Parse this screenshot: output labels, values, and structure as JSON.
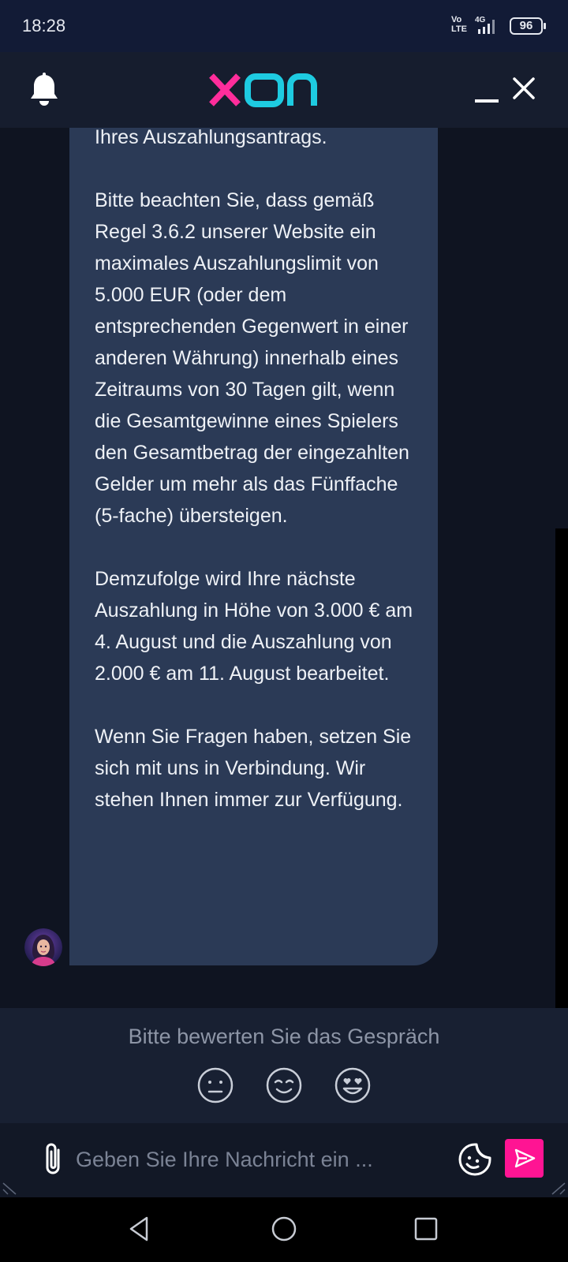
{
  "status_bar": {
    "time": "18:28",
    "network_line1": "Vo",
    "network_line2": "LTE",
    "network_type": "4G",
    "battery": "96"
  },
  "header": {
    "logo_text": "xon",
    "icons": [
      "bell-icon",
      "minimize-icon",
      "close-icon"
    ],
    "logo_colors": {
      "x": "#ff2d9b",
      "on": "#1ecbe1"
    }
  },
  "chat": {
    "message": {
      "paragraphs": [
        "Ihres Auszahlungsantrags.",
        "Bitte beachten Sie, dass gemäß Regel 3.6.2 unserer Website ein maximales Auszahlungslimit von 5.000 EUR (oder dem entsprechenden Gegenwert in einer anderen Währung) innerhalb eines Zeitraums von 30 Tagen gilt, wenn die Gesamtgewinne eines Spielers den Gesamtbetrag der eingezahlten Gelder um mehr als das Fünffache (5-fache) übersteigen.",
        "Demzufolge wird Ihre nächste Auszahlung in Höhe von 3.000 € am 4. August und die Auszahlung von 2.000 € am 11. August bearbeitet.",
        "Wenn Sie Fragen haben, setzen Sie sich mit uns in Verbindung. Wir stehen Ihnen immer zur Verfügung."
      ]
    }
  },
  "rating": {
    "prompt": "Bitte bewerten Sie das Gespräch",
    "options": [
      "neutral-face-icon",
      "smiling-face-icon",
      "heart-eyes-face-icon"
    ]
  },
  "composer": {
    "placeholder": "Geben Sie Ihre Nachricht ein ...",
    "value": ""
  },
  "colors": {
    "accent": "#ff1493",
    "bubble": "#2b3a56",
    "background": "#0f1421"
  }
}
